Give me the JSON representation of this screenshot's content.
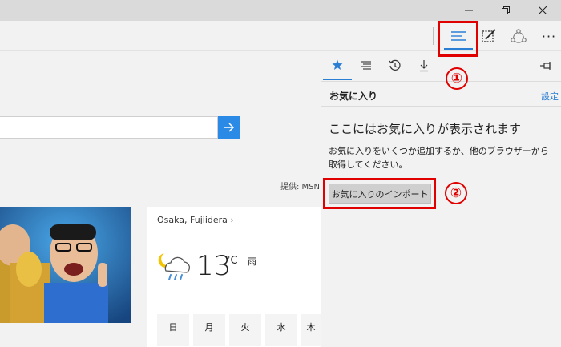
{
  "titlebar": {
    "minimize_icon": "minimize-icon",
    "restore_icon": "restore-icon",
    "close_icon": "close-icon"
  },
  "toolbar": {
    "hub_icon": "hub-icon",
    "note_icon": "web-note-icon",
    "share_icon": "share-icon",
    "more_label": "···"
  },
  "annotations": {
    "badge1": "①",
    "badge2": "②",
    "highlight_color": "#e00000"
  },
  "page": {
    "provided_by": "提供: MSN",
    "weather": {
      "location": "Osaka, Fujiidera",
      "temperature": "13",
      "unit": "°C",
      "condition": "雨",
      "days": [
        "日",
        "月",
        "火",
        "水",
        "木"
      ]
    }
  },
  "hub": {
    "tabs": [
      "favorites-icon",
      "reading-list-icon",
      "history-icon",
      "downloads-icon"
    ],
    "pin_icon": "pin-icon",
    "title": "お気に入り",
    "settings_label": "設定",
    "empty_heading": "ここにはお気に入りが表示されます",
    "empty_description": "お気に入りをいくつか追加するか、他のブラウザーから取得してください。",
    "import_button": "お気に入りのインポート"
  },
  "colors": {
    "accent": "#2a7fd4",
    "search_button": "#2a8ae6"
  }
}
